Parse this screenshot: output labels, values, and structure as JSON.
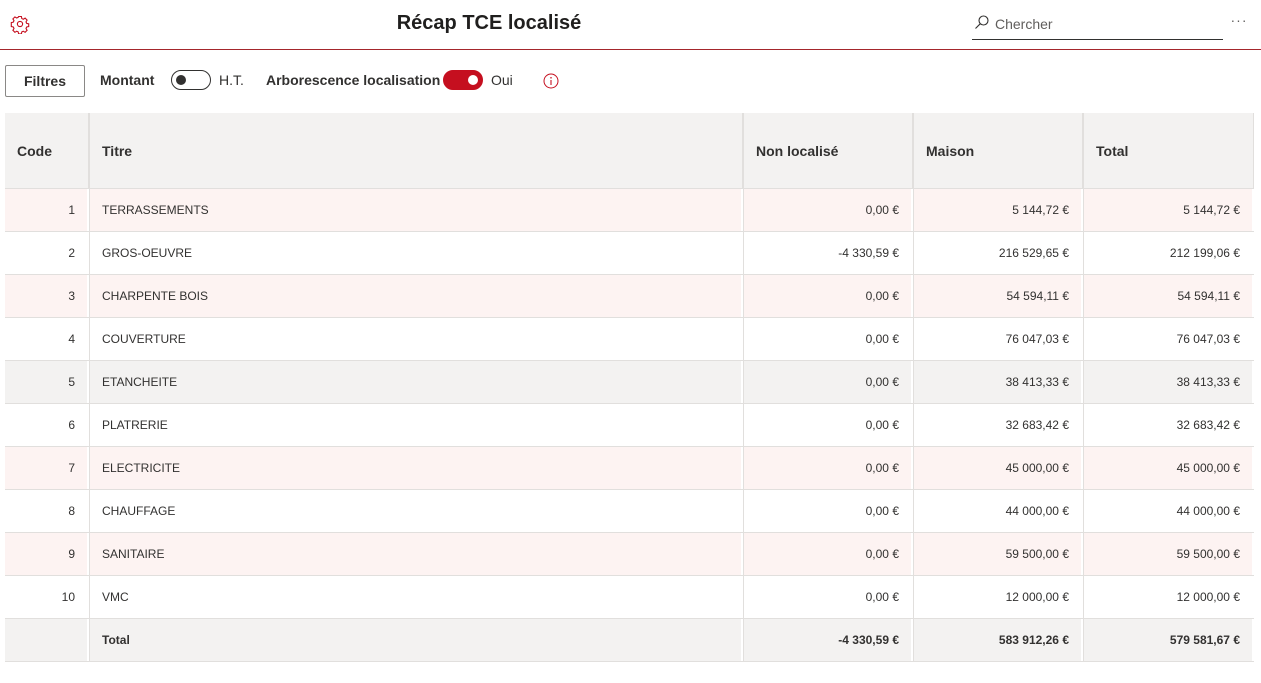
{
  "header": {
    "title": "Récap TCE localisé",
    "search_placeholder": "Chercher",
    "more_label": "···"
  },
  "toolbar": {
    "filters_label": "Filtres",
    "montant_label": "Montant",
    "montant_value": "H.T.",
    "montant_toggle_on": false,
    "arbo_label": "Arborescence localisation",
    "arbo_value": "Oui",
    "arbo_toggle_on": true
  },
  "table": {
    "columns": [
      "Code",
      "Titre",
      "Non localisé",
      "Maison",
      "Total"
    ],
    "rows": [
      {
        "code": "1",
        "titre": "TERRASSEMENTS",
        "non_localise": "0,00 €",
        "maison": "5 144,72 €",
        "total": "5 144,72 €"
      },
      {
        "code": "2",
        "titre": "GROS-OEUVRE",
        "non_localise": "-4 330,59 €",
        "maison": "216 529,65 €",
        "total": "212 199,06 €"
      },
      {
        "code": "3",
        "titre": "CHARPENTE BOIS",
        "non_localise": "0,00 €",
        "maison": "54 594,11 €",
        "total": "54 594,11 €"
      },
      {
        "code": "4",
        "titre": "COUVERTURE",
        "non_localise": "0,00 €",
        "maison": "76 047,03 €",
        "total": "76 047,03 €"
      },
      {
        "code": "5",
        "titre": "ETANCHEITE",
        "non_localise": "0,00 €",
        "maison": "38 413,33 €",
        "total": "38 413,33 €"
      },
      {
        "code": "6",
        "titre": "PLATRERIE",
        "non_localise": "0,00 €",
        "maison": "32 683,42 €",
        "total": "32 683,42 €"
      },
      {
        "code": "7",
        "titre": "ELECTRICITE",
        "non_localise": "0,00 €",
        "maison": "45 000,00 €",
        "total": "45 000,00 €"
      },
      {
        "code": "8",
        "titre": "CHAUFFAGE",
        "non_localise": "0,00 €",
        "maison": "44 000,00 €",
        "total": "44 000,00 €"
      },
      {
        "code": "9",
        "titre": "SANITAIRE",
        "non_localise": "0,00 €",
        "maison": "59 500,00 €",
        "total": "59 500,00 €"
      },
      {
        "code": "10",
        "titre": "VMC",
        "non_localise": "0,00 €",
        "maison": "12 000,00 €",
        "total": "12 000,00 €"
      }
    ],
    "totals": {
      "code": "",
      "titre": "Total",
      "non_localise": "-4 330,59 €",
      "maison": "583 912,26 €",
      "total": "579 581,67 €"
    }
  },
  "colors": {
    "accent": "#c50f1f",
    "header_border": "#a4262c",
    "row_pink": "#fdf3f2",
    "row_gray": "#f3f2f1"
  },
  "icons": {
    "settings": "gear-icon",
    "search": "search-icon",
    "more": "more-icon",
    "info": "info-icon"
  }
}
